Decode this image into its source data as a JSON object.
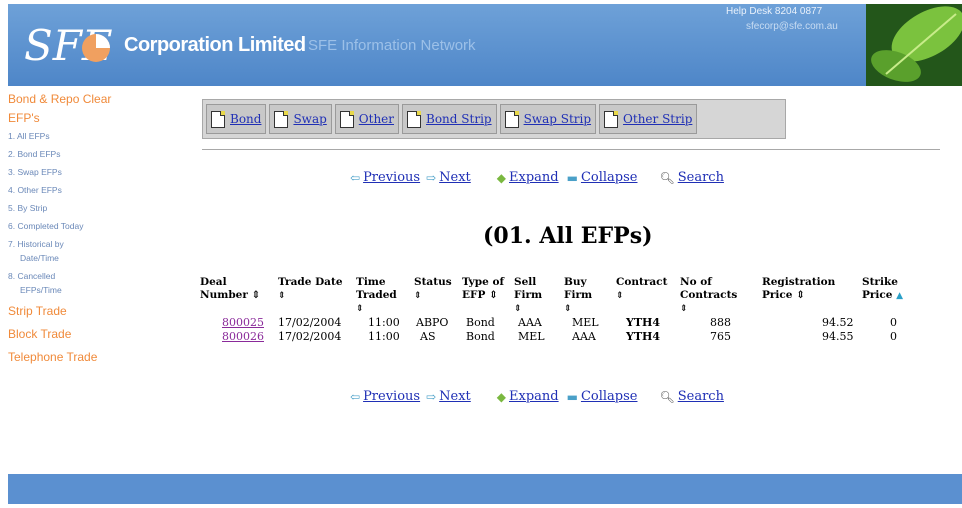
{
  "header": {
    "brand": "Corporation Limited",
    "subtitle": "SFE Information Network",
    "helpdesk": "Help Desk 8204 0877",
    "helpmail": "sfecorp@sfe.com.au"
  },
  "sidebar": {
    "sections": [
      {
        "label": "Bond & Repo Clear"
      },
      {
        "label": "EFP's"
      }
    ],
    "items": [
      {
        "label": "1. All EFPs"
      },
      {
        "label": "2. Bond EFPs"
      },
      {
        "label": "3. Swap EFPs"
      },
      {
        "label": "4. Other EFPs"
      },
      {
        "label": "5. By Strip"
      },
      {
        "label": "6. Completed Today"
      },
      {
        "label": "7. Historical by"
      },
      {
        "label": "Date/Time"
      },
      {
        "label": "8. Cancelled"
      },
      {
        "label": "EFPs/Time"
      }
    ],
    "more": [
      {
        "label": "Strip Trade"
      },
      {
        "label": "Block Trade"
      },
      {
        "label": "Telephone Trade"
      }
    ]
  },
  "tabs": [
    "Bond",
    "Swap",
    "Other",
    "Bond Strip",
    "Swap Strip",
    "Other Strip"
  ],
  "nav": {
    "previous": "Previous",
    "next": "Next",
    "expand": "Expand",
    "collapse": "Collapse",
    "search": "Search"
  },
  "page_title": "(01. All EFPs)",
  "table": {
    "headers": [
      [
        "Deal",
        "Number ⇕"
      ],
      [
        "Trade Date",
        "⇕"
      ],
      [
        "Time",
        "Traded",
        "⇕"
      ],
      [
        "Status",
        "⇕"
      ],
      [
        "Type of",
        "EFP ⇕"
      ],
      [
        "Sell",
        "Firm",
        "⇕"
      ],
      [
        "Buy",
        "Firm",
        "⇕"
      ],
      [
        "Contract",
        "⇕"
      ],
      [
        "No of",
        "Contracts",
        "⇕"
      ],
      [
        "Registration",
        "Price ⇕"
      ],
      [
        "Strike",
        "Price"
      ]
    ],
    "rows": [
      {
        "deal": "800025",
        "date": "17/02/2004",
        "time": "11:00",
        "status": "ABPO",
        "type": "Bond",
        "sell": "AAA",
        "buy": "MEL",
        "contract": "YTH4",
        "contracts": "888",
        "reg_price": "94.52",
        "strike": "0"
      },
      {
        "deal": "800026",
        "date": "17/02/2004",
        "time": "11:00",
        "status": "AS",
        "type": "Bond",
        "sell": "MEL",
        "buy": "AAA",
        "contract": "YTH4",
        "contracts": "765",
        "reg_price": "94.55",
        "strike": "0"
      }
    ]
  },
  "colors": {
    "header_blue": "#5b90d0",
    "sidebar_orange": "#f08a3a",
    "link_blue": "#1f2fb5",
    "deal_link": "#8a2a9a"
  }
}
